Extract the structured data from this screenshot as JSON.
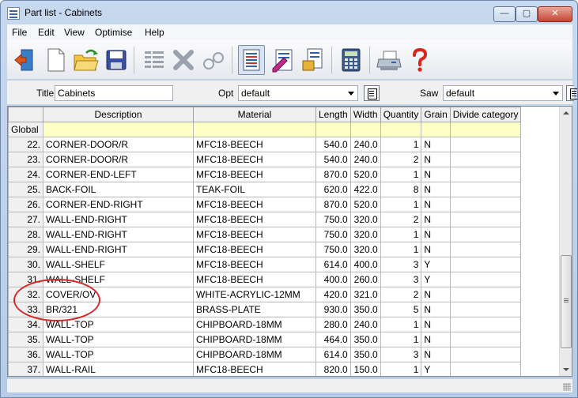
{
  "window": {
    "title": "Part list - Cabinets",
    "minimize_label": "—",
    "maximize_label": "▢",
    "close_label": "✕"
  },
  "menu": [
    "File",
    "Edit",
    "View",
    "Optimise",
    "Help"
  ],
  "toolbar": {
    "buttons": [
      {
        "name": "exit-icon"
      },
      {
        "name": "new-document-icon"
      },
      {
        "name": "open-folder-icon"
      },
      {
        "name": "save-disk-icon"
      },
      {
        "name": "list-rows-icon"
      },
      {
        "name": "delete-x-icon"
      },
      {
        "name": "search-glasses-icon"
      },
      {
        "name": "part-list-icon",
        "pressed": true
      },
      {
        "name": "edit-list-icon"
      },
      {
        "name": "optimise-list-icon"
      },
      {
        "name": "calculator-icon"
      },
      {
        "name": "printer-icon"
      },
      {
        "name": "help-question-icon"
      }
    ]
  },
  "params": {
    "title_label": "Title",
    "title_value": "Cabinets",
    "opt_label": "Opt",
    "opt_value": "default",
    "saw_label": "Saw",
    "saw_value": "default"
  },
  "grid": {
    "columns": [
      "",
      "Description",
      "Material",
      "Length",
      "Width",
      "Quantity",
      "Grain",
      "Divide category"
    ],
    "global_label": "Global",
    "rows": [
      {
        "no": "22.",
        "description": "CORNER-DOOR/R",
        "material": "MFC18-BEECH",
        "length": "540.0",
        "width": "240.0",
        "quantity": "1",
        "grain": "N",
        "divide": ""
      },
      {
        "no": "23.",
        "description": "CORNER-DOOR/R",
        "material": "MFC18-BEECH",
        "length": "540.0",
        "width": "240.0",
        "quantity": "2",
        "grain": "N",
        "divide": ""
      },
      {
        "no": "24.",
        "description": "CORNER-END-LEFT",
        "material": "MFC18-BEECH",
        "length": "870.0",
        "width": "520.0",
        "quantity": "1",
        "grain": "N",
        "divide": ""
      },
      {
        "no": "25.",
        "description": "BACK-FOIL",
        "material": "TEAK-FOIL",
        "length": "620.0",
        "width": "422.0",
        "quantity": "8",
        "grain": "N",
        "divide": ""
      },
      {
        "no": "26.",
        "description": "CORNER-END-RIGHT",
        "material": "MFC18-BEECH",
        "length": "870.0",
        "width": "520.0",
        "quantity": "1",
        "grain": "N",
        "divide": ""
      },
      {
        "no": "27.",
        "description": "WALL-END-RIGHT",
        "material": "MFC18-BEECH",
        "length": "750.0",
        "width": "320.0",
        "quantity": "2",
        "grain": "N",
        "divide": ""
      },
      {
        "no": "28.",
        "description": "WALL-END-RIGHT",
        "material": "MFC18-BEECH",
        "length": "750.0",
        "width": "320.0",
        "quantity": "1",
        "grain": "N",
        "divide": ""
      },
      {
        "no": "29.",
        "description": "WALL-END-RIGHT",
        "material": "MFC18-BEECH",
        "length": "750.0",
        "width": "320.0",
        "quantity": "1",
        "grain": "N",
        "divide": ""
      },
      {
        "no": "30.",
        "description": "WALL-SHELF",
        "material": "MFC18-BEECH",
        "length": "614.0",
        "width": "400.0",
        "quantity": "3",
        "grain": "Y",
        "divide": ""
      },
      {
        "no": "31.",
        "description": "WALL-SHELF",
        "material": "MFC18-BEECH",
        "length": "400.0",
        "width": "260.0",
        "quantity": "3",
        "grain": "Y",
        "divide": ""
      },
      {
        "no": "32.",
        "description": "COVER/OV",
        "material": "WHITE-ACRYLIC-12MM",
        "length": "420.0",
        "width": "321.0",
        "quantity": "2",
        "grain": "N",
        "divide": ""
      },
      {
        "no": "33.",
        "description": "BR/321",
        "material": "BRASS-PLATE",
        "length": "930.0",
        "width": "350.0",
        "quantity": "5",
        "grain": "N",
        "divide": ""
      },
      {
        "no": "34.",
        "description": "WALL-TOP",
        "material": "CHIPBOARD-18MM",
        "length": "280.0",
        "width": "240.0",
        "quantity": "1",
        "grain": "N",
        "divide": ""
      },
      {
        "no": "35.",
        "description": "WALL-TOP",
        "material": "CHIPBOARD-18MM",
        "length": "464.0",
        "width": "350.0",
        "quantity": "1",
        "grain": "N",
        "divide": ""
      },
      {
        "no": "36.",
        "description": "WALL-TOP",
        "material": "CHIPBOARD-18MM",
        "length": "614.0",
        "width": "350.0",
        "quantity": "3",
        "grain": "N",
        "divide": ""
      },
      {
        "no": "37.",
        "description": "WALL-RAIL",
        "material": "MFC18-BEECH",
        "length": "820.0",
        "width": "150.0",
        "quantity": "1",
        "grain": "Y",
        "divide": ""
      }
    ]
  },
  "colors": {
    "global_row": "#ffffc8",
    "annotation": "#d32a2a"
  }
}
